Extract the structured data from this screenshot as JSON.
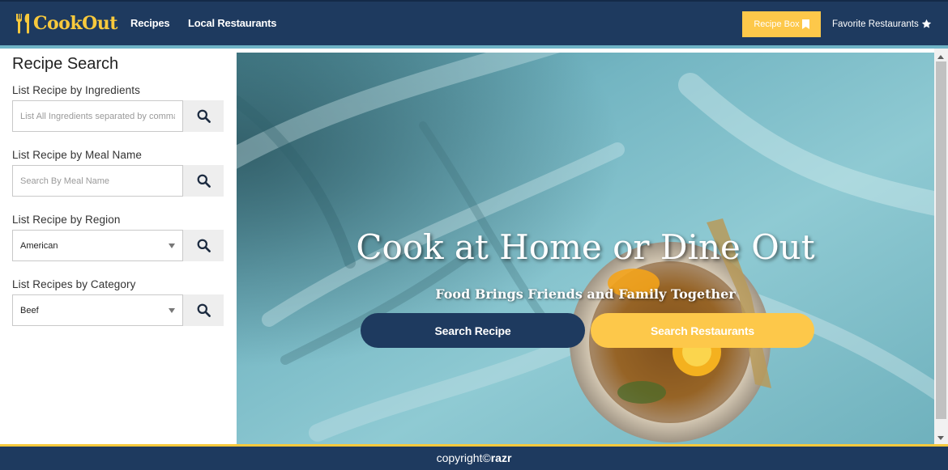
{
  "colors": {
    "navy": "#1e3a5f",
    "gold": "#f8c93c",
    "gold_button": "#fdc84a",
    "teal_accent": "#6fb3c6"
  },
  "navbar": {
    "brand": "CookOut",
    "brand_icon": "fork-knife-icon",
    "links": [
      "Recipes",
      "Local Restaurants"
    ],
    "recipe_box_label": "Recipe Box",
    "recipe_box_icon": "bookmark-icon",
    "favorites_label": "Favorite Restaurants",
    "favorites_icon": "star-icon"
  },
  "sidebar": {
    "title": "Recipe Search",
    "fields": [
      {
        "label": "List Recipe by Ingredients",
        "type": "input",
        "placeholder": "List All Ingredients separated by comma",
        "value": ""
      },
      {
        "label": "List Recipe by Meal Name",
        "type": "input",
        "placeholder": "Search By Meal Name",
        "value": ""
      },
      {
        "label": "List Recipe by Region",
        "type": "select",
        "value": "American"
      },
      {
        "label": "List Recipes by Category",
        "type": "select",
        "value": "Beef"
      }
    ],
    "search_icon": "search-icon"
  },
  "hero": {
    "title": "Cook at Home or Dine Out",
    "subtitle": "Food Brings Friends and Family Together",
    "primary_button": "Search Recipe",
    "secondary_button": "Search Restaurants"
  },
  "footer": {
    "prefix": "copyright©",
    "name": "razr"
  }
}
